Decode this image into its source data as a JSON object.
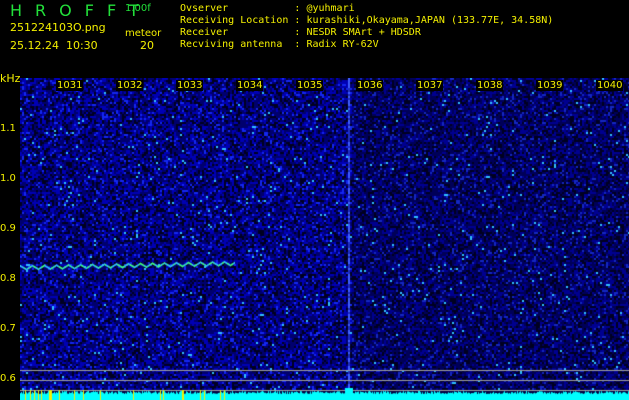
{
  "header": {
    "title": "HROFFT",
    "version": "1.00f",
    "filename": "251224103O.png",
    "datetime": "25.12.24  10:30",
    "meteor_label": "meteor",
    "meteor_count": "20"
  },
  "info": [
    {
      "label": "Ovserver          ",
      "value": ": @yuhmari"
    },
    {
      "label": "Receiving Location",
      "value": ": kurashiki,Okayama,JAPAN (133.77E, 34.58N)"
    },
    {
      "label": "Receiver          ",
      "value": ": NESDR SMArt + HDSDR"
    },
    {
      "label": "Recviving antenna ",
      "value": ": Radix RY-62V"
    }
  ],
  "axis": {
    "y_unit": "kHz",
    "y_ticks": [
      "1.1",
      "1.0",
      "0.9",
      "0.8",
      "0.7",
      "0.6"
    ],
    "x_ticks": [
      "1031",
      "1032",
      "1033",
      "1034",
      "1035",
      "1036",
      "1037",
      "1038",
      "1039",
      "1040"
    ]
  },
  "colors": {
    "text_yellow": "#f4f000",
    "text_green": "#22e03a",
    "spectrum": "#00ffff",
    "background": "#00008a"
  }
}
